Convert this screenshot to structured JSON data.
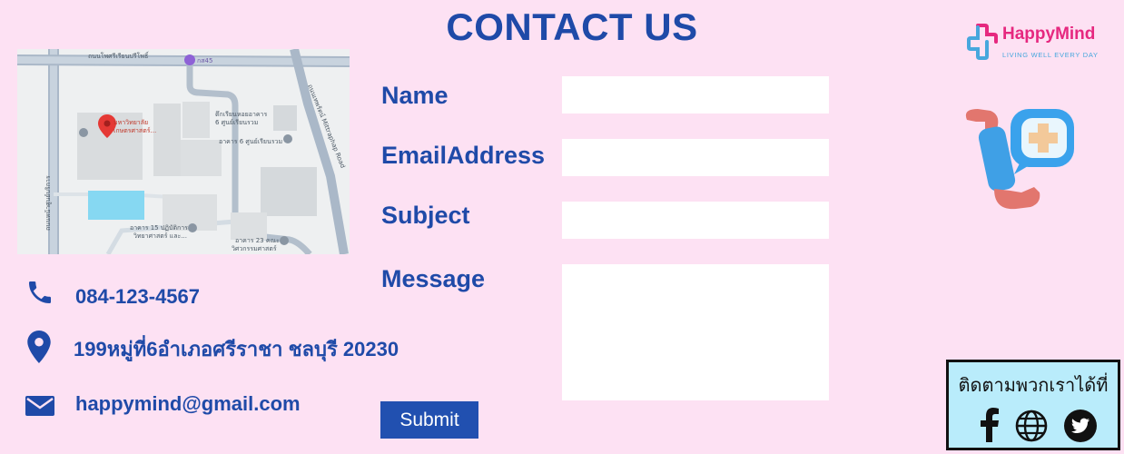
{
  "page_title": "CONTACT US",
  "brand": {
    "name": "HappyMind",
    "tagline": "LIVING WELL EVERY DAY"
  },
  "map": {
    "road_top": "ถนนโพศรีเรียนปรีโพธิ์",
    "road_right": "ถนนเทพรัตน์ Mittraphap Road",
    "road_left": "ถนนหน้าศูนย์บริการ",
    "university": "มหาวิทยาลัย",
    "university_2": "เกษตรศาสตร์...",
    "building_1": "ตึกเรียนหอยอาคาร",
    "building_1b": "6 ศูนย์เรียนรวม",
    "building_2": "อาคาร 6 ศูนย์เรียนรวม",
    "building_3": "อาคาร 15 ปฏิบัติการ",
    "building_3b": "วิทยาศาสตร์ และ...",
    "building_4": "อาคาร 23 คณะ",
    "building_4b": "วิศวกรรมศาสตร์",
    "route_badge": "กส45"
  },
  "contact": {
    "phone": "084-123-4567",
    "address": "199หมู่ที่6อำเภอศรีราชา ชลบุรี 20230",
    "email": "happymind@gmail.com"
  },
  "form": {
    "name_label": "Name",
    "email_label": "EmailAddress",
    "subject_label": "Subject",
    "message_label": "Message",
    "name_value": "",
    "email_value": "",
    "subject_value": "",
    "message_value": "",
    "submit_label": "Submit"
  },
  "social": {
    "label": "ติดตามพวกเราได้ที่",
    "icons": [
      "facebook-icon",
      "globe-icon",
      "twitter-icon"
    ]
  },
  "colors": {
    "background": "#fde1f3",
    "heading": "#1f4aa8",
    "button": "#2150b0",
    "brand_pink": "#e6287f",
    "brand_blue": "#47a7dd",
    "social_bg": "#b9ecfb"
  }
}
